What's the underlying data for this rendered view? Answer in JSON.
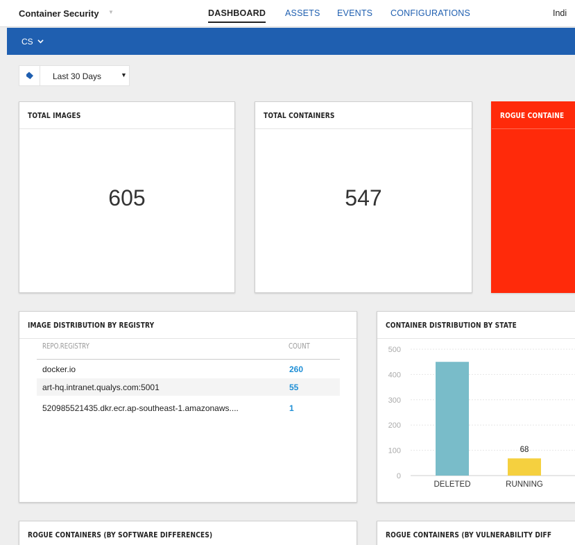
{
  "header": {
    "app_title": "Container Security",
    "app_caret": "▼",
    "tabs": [
      {
        "label": "DASHBOARD",
        "active": true
      },
      {
        "label": "ASSETS",
        "active": false
      },
      {
        "label": "EVENTS",
        "active": false
      },
      {
        "label": "CONFIGURATIONS",
        "active": false
      }
    ],
    "user_label": "Indi"
  },
  "subbar": {
    "dashboard_name": "CS",
    "color": "#1f5fb0"
  },
  "filter": {
    "tag_icon": "tag-icon",
    "range_label": "Last 30 Days",
    "caret": "▼"
  },
  "widgets": {
    "total_images": {
      "title": "TOTAL IMAGES",
      "value": "605"
    },
    "total_containers": {
      "title": "TOTAL CONTAINERS",
      "value": "547"
    },
    "rogue_containers": {
      "title": "ROGUE CONTAINE",
      "color": "#ff2a0a"
    },
    "image_distribution": {
      "title": "IMAGE DISTRIBUTION BY REGISTRY",
      "columns": [
        "REPO.REGISTRY",
        "COUNT"
      ],
      "rows": [
        {
          "name": "docker.io",
          "count": "260"
        },
        {
          "name": "art-hq.intranet.qualys.com:5001",
          "count": "55"
        },
        {
          "name": "520985521435.dkr.ecr.ap-southeast-1.amazonaws....",
          "count": "1"
        }
      ]
    },
    "container_distribution": {
      "title": "CONTAINER DISTRIBUTION BY STATE"
    },
    "rogue_software": {
      "title": "ROGUE CONTAINERS (BY SOFTWARE DIFFERENCES)"
    },
    "rogue_vuln": {
      "title": "ROGUE CONTAINERS (BY VULNERABILITY DIFF"
    }
  },
  "chart_data": {
    "type": "bar",
    "categories": [
      "DELETED",
      "RUNNING"
    ],
    "values": [
      450,
      68
    ],
    "data_labels": [
      "",
      "68"
    ],
    "colors": [
      "#79bcc9",
      "#f5d03f"
    ],
    "yticks": [
      "0",
      "100",
      "200",
      "300",
      "400",
      "500"
    ],
    "ylim": [
      0,
      500
    ],
    "grid": true
  }
}
